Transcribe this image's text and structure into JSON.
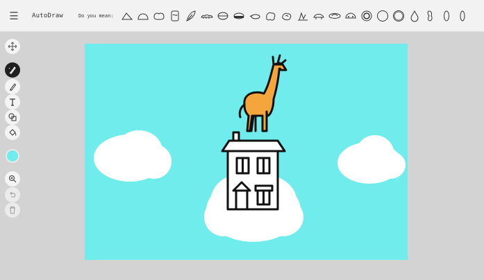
{
  "app": {
    "title": "AutoDraw"
  },
  "topbar": {
    "menu_icon": "hamburger-menu-icon",
    "suggest_label": "Do you mean:",
    "suggestions": [
      "cloud",
      "cloud",
      "cloud",
      "cloud",
      "cloud",
      "feather",
      "cloud",
      "cloud",
      "cloud",
      "cloud",
      "cloud",
      "cloud",
      "cloud",
      "cloud",
      "cloud",
      "cloud",
      "cloud",
      "circle",
      "circle",
      "circle",
      "drop",
      "peanut",
      "oval",
      "oval"
    ]
  },
  "toolbar": {
    "tools": [
      {
        "name": "move",
        "icon": "move-arrows-icon",
        "state": "normal"
      },
      {
        "name": "autodraw",
        "icon": "autodraw-pen-icon",
        "state": "active"
      },
      {
        "name": "draw",
        "icon": "pencil-icon",
        "state": "normal"
      },
      {
        "name": "type",
        "icon": "type-text-icon",
        "state": "normal"
      },
      {
        "name": "shape",
        "icon": "shape-icon",
        "state": "normal"
      },
      {
        "name": "fill",
        "icon": "fill-bucket-icon",
        "state": "normal"
      },
      {
        "name": "zoom",
        "icon": "zoom-icon",
        "state": "normal"
      },
      {
        "name": "undo",
        "icon": "undo-icon",
        "state": "disabled"
      },
      {
        "name": "delete",
        "icon": "trash-icon",
        "state": "disabled"
      }
    ],
    "color": "#6feceb"
  },
  "canvas": {
    "background": "#6feceb",
    "objects": [
      "cloud",
      "cloud",
      "cloud",
      "house",
      "giraffe"
    ],
    "giraffe_color": "#f4a53c",
    "stroke_color": "#111111",
    "cloud_color": "#ffffff"
  }
}
